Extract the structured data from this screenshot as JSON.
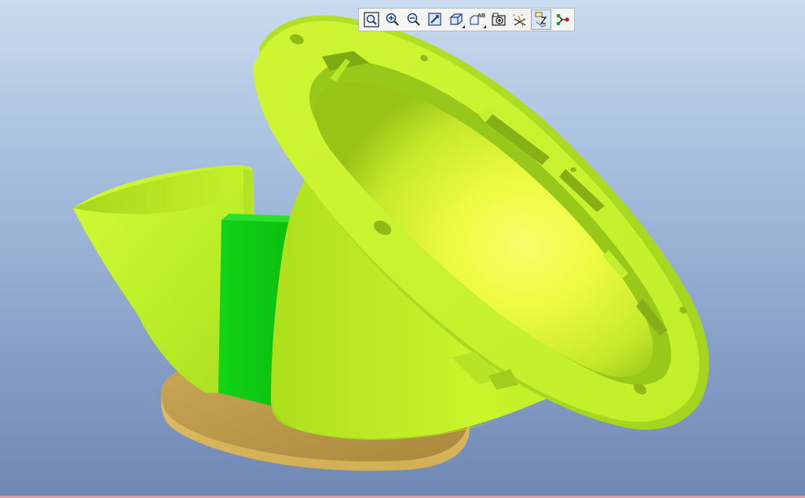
{
  "window": {
    "type": "3d-cad-viewport"
  },
  "toolbar": {
    "buttons": [
      {
        "icon": "zoom-window-icon",
        "active": false
      },
      {
        "icon": "zoom-in-icon",
        "active": false
      },
      {
        "icon": "zoom-out-icon",
        "active": false
      },
      {
        "icon": "repaint-icon",
        "active": false
      },
      {
        "icon": "display-style-icon",
        "active": false,
        "dropdown": true
      },
      {
        "icon": "saved-views-icon",
        "active": false,
        "dropdown": true,
        "label": "AB"
      },
      {
        "icon": "view-manager-icon",
        "active": false
      },
      {
        "icon": "datum-display-icon",
        "active": false
      },
      {
        "icon": "annotation-display-icon",
        "active": true
      },
      {
        "icon": "spin-center-icon",
        "active": false
      }
    ],
    "saved_views_label": "AB"
  },
  "model": {
    "parts": [
      {
        "name": "flange-ring",
        "color": "#c4f42c"
      },
      {
        "name": "main-cone",
        "color": "#c8f52a"
      },
      {
        "name": "side-cone",
        "color": "#c2f52a"
      },
      {
        "name": "green-block",
        "color": "#16d31a"
      },
      {
        "name": "base-plate",
        "color": "#d6b564"
      }
    ]
  },
  "colors": {
    "background_top": "#c9dcee",
    "background_bottom": "#6f87b3",
    "part_primary": "#c4f42c",
    "part_secondary": "#16d31a",
    "part_base": "#d6b564"
  }
}
